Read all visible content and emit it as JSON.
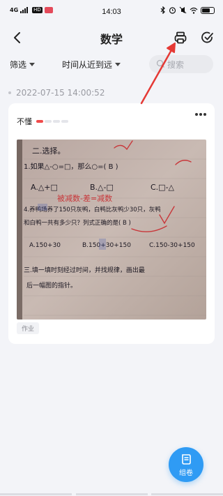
{
  "status_bar": {
    "network": "4G",
    "time": "14:03",
    "icons": [
      "bluetooth-icon",
      "alarm-icon",
      "mute-icon",
      "wifi-icon",
      "battery-icon"
    ]
  },
  "header": {
    "title": "数学",
    "back_icon": "chevron-left-icon",
    "print_icon": "printer-icon",
    "select_icon": "check-circle-icon"
  },
  "filters": {
    "filter_label": "筛选",
    "sort_label": "时间从近到远",
    "search_placeholder": "搜索"
  },
  "colors": {
    "accent": "#2f9bf4",
    "annotation_arrow": "#e53935",
    "level_on": "#f04b4b"
  },
  "entry": {
    "timestamp": "2022-07-15 14:00:52",
    "mastery_label": "不懂",
    "mastery_level": 1,
    "mastery_max": 4,
    "tag": "作业",
    "photo": {
      "line1": "二.选择。",
      "line2": "1.如果△-○=□，那么○=( B )",
      "options1": [
        "A.△+□",
        "B.△-□",
        "C.□-△"
      ],
      "red_note": "被减数-差=减数",
      "line3": "4.养鸭场养了150只灰鸭，白鸭比灰鸭少30只，灰鸭",
      "line4": "和白鸭一共有多少只？列式正确的是( B )",
      "options2": [
        "A.150+30",
        "B.150+30+150",
        "C.150-30+150"
      ],
      "line5": "三.填一填时刻经过时间，并找规律，画出最",
      "line6": "后一幅图的指针。"
    }
  },
  "fab": {
    "label": "组卷",
    "icon": "scroll-icon"
  }
}
